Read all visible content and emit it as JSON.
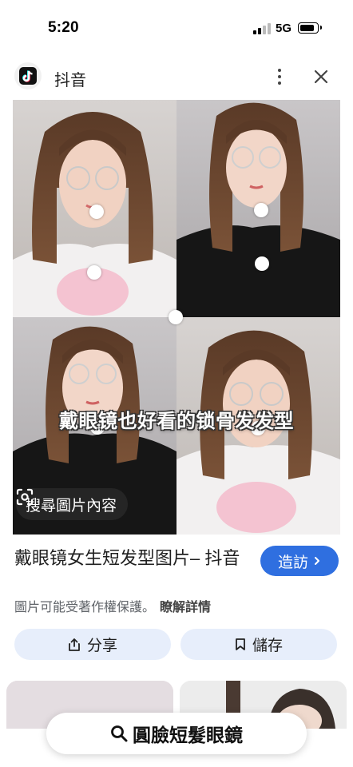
{
  "status_bar": {
    "time": "5:20",
    "network": "5G"
  },
  "header": {
    "source_name": "抖音",
    "logo_icon": "tiktok-logo-icon"
  },
  "image": {
    "overlay_caption": "戴眼镜也好看的锁骨发发型",
    "lens_label": "搜尋圖片內容"
  },
  "info": {
    "title": "戴眼镜女生短发型图片– 抖音",
    "visit_label": "造訪",
    "copyright": "圖片可能受著作權保護。",
    "learn_more": "瞭解詳情",
    "share_label": "分享",
    "save_label": "儲存"
  },
  "bottom_search": {
    "query": "圓臉短髮眼鏡"
  },
  "colors": {
    "accent": "#2f6fe0",
    "chip_bg": "#e7eefb"
  }
}
